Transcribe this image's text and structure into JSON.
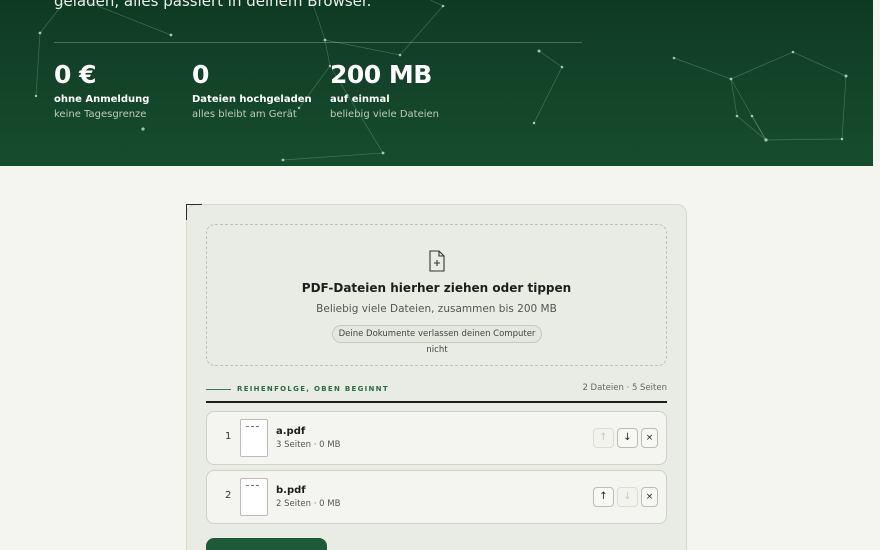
{
  "hero": {
    "tagline": "geladen, alles passiert in deinem Browser.",
    "stats": [
      {
        "value": "0 €",
        "label": "ohne Anmeldung",
        "sub": "keine Tagesgrenze"
      },
      {
        "value": "0",
        "label": "Dateien hochgeladen",
        "sub": "alles bleibt am Gerät"
      },
      {
        "value": "200 MB",
        "label": "auf einmal",
        "sub": "beliebig viele Dateien"
      }
    ]
  },
  "dropzone": {
    "icon": "file-plus-icon",
    "title": "PDF-Dateien hierher ziehen oder tippen",
    "hint": "Beliebig viele Dateien, zusammen bis 200 MB",
    "privacy": "Deine Dokumente verlassen deinen Computer nicht"
  },
  "order": {
    "label": "REIHENFOLGE, OBEN BEGINNT",
    "count": "2 Dateien · 5 Seiten"
  },
  "files": [
    {
      "index": "1",
      "name": "a.pdf",
      "meta": "3 Seiten · 0 MB"
    },
    {
      "index": "2",
      "name": "b.pdf",
      "meta": "2 Seiten · 0 MB"
    }
  ],
  "controls": {
    "up": "↑",
    "down": "↓",
    "remove": "×"
  },
  "colors": {
    "hero": "#174d2e",
    "accent": "#1f5a38",
    "card": "#e9ece4"
  }
}
